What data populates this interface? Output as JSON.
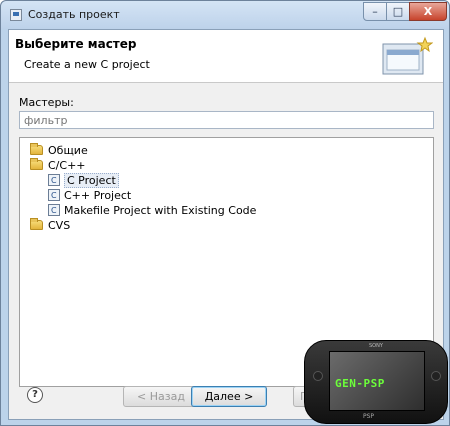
{
  "window": {
    "title": "Создать проект",
    "controls": {
      "minimize": "–",
      "maximize": "□",
      "close": "X"
    }
  },
  "header": {
    "title": "Выберите мастер",
    "subtitle": "Create a new C project"
  },
  "wizards_label": "Мастеры:",
  "filter": {
    "placeholder": "фильтр",
    "value": ""
  },
  "tree": [
    {
      "label": "Общие",
      "type": "folder",
      "level": 0
    },
    {
      "label": "C/C++",
      "type": "folder",
      "level": 0
    },
    {
      "label": "C Project",
      "type": "project",
      "level": 1,
      "selected": true
    },
    {
      "label": "C++ Project",
      "type": "project",
      "level": 1
    },
    {
      "label": "Makefile Project with Existing Code",
      "type": "project",
      "level": 1
    },
    {
      "label": "CVS",
      "type": "folder",
      "level": 0
    }
  ],
  "buttons": {
    "help": "?",
    "back": "< Назад",
    "next": "Далее >",
    "finish": "Гот"
  },
  "overlay": {
    "logo": "GEN-PSP",
    "brand": "SONY",
    "model": "PSP"
  }
}
